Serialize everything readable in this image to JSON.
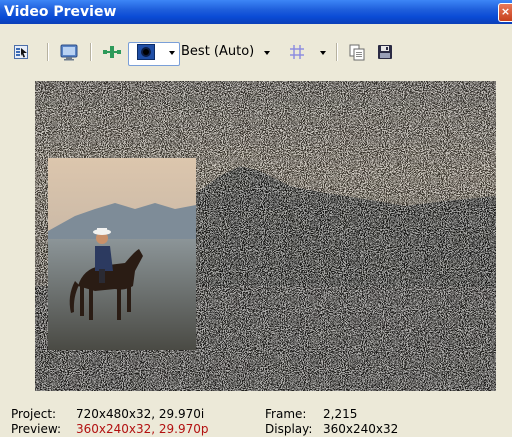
{
  "window": {
    "title": "Video Preview",
    "close_glyph": "×"
  },
  "toolbar": {
    "tools": [
      {
        "name": "properties-icon"
      },
      {
        "name": "monitor-icon"
      },
      {
        "name": "split-screen-icon"
      },
      {
        "name": "preview-mode-icon"
      }
    ],
    "quality_label": "Best (Auto)",
    "grid_icon": "grid-icon",
    "copy_icon": "copy-snapshot-icon",
    "save_icon": "save-snapshot-icon"
  },
  "status": {
    "project_label": "Project:",
    "project_value": "720x480x32, 29.970i",
    "preview_label": "Preview:",
    "preview_value": "360x240x32, 29.970p",
    "frame_label": "Frame:",
    "frame_value": "2,215",
    "display_label": "Display:",
    "display_value": "360x240x32"
  },
  "colors": {
    "title_bar": "#1f5fdc",
    "background": "#ece9d8",
    "preview_value": "#b21010"
  }
}
